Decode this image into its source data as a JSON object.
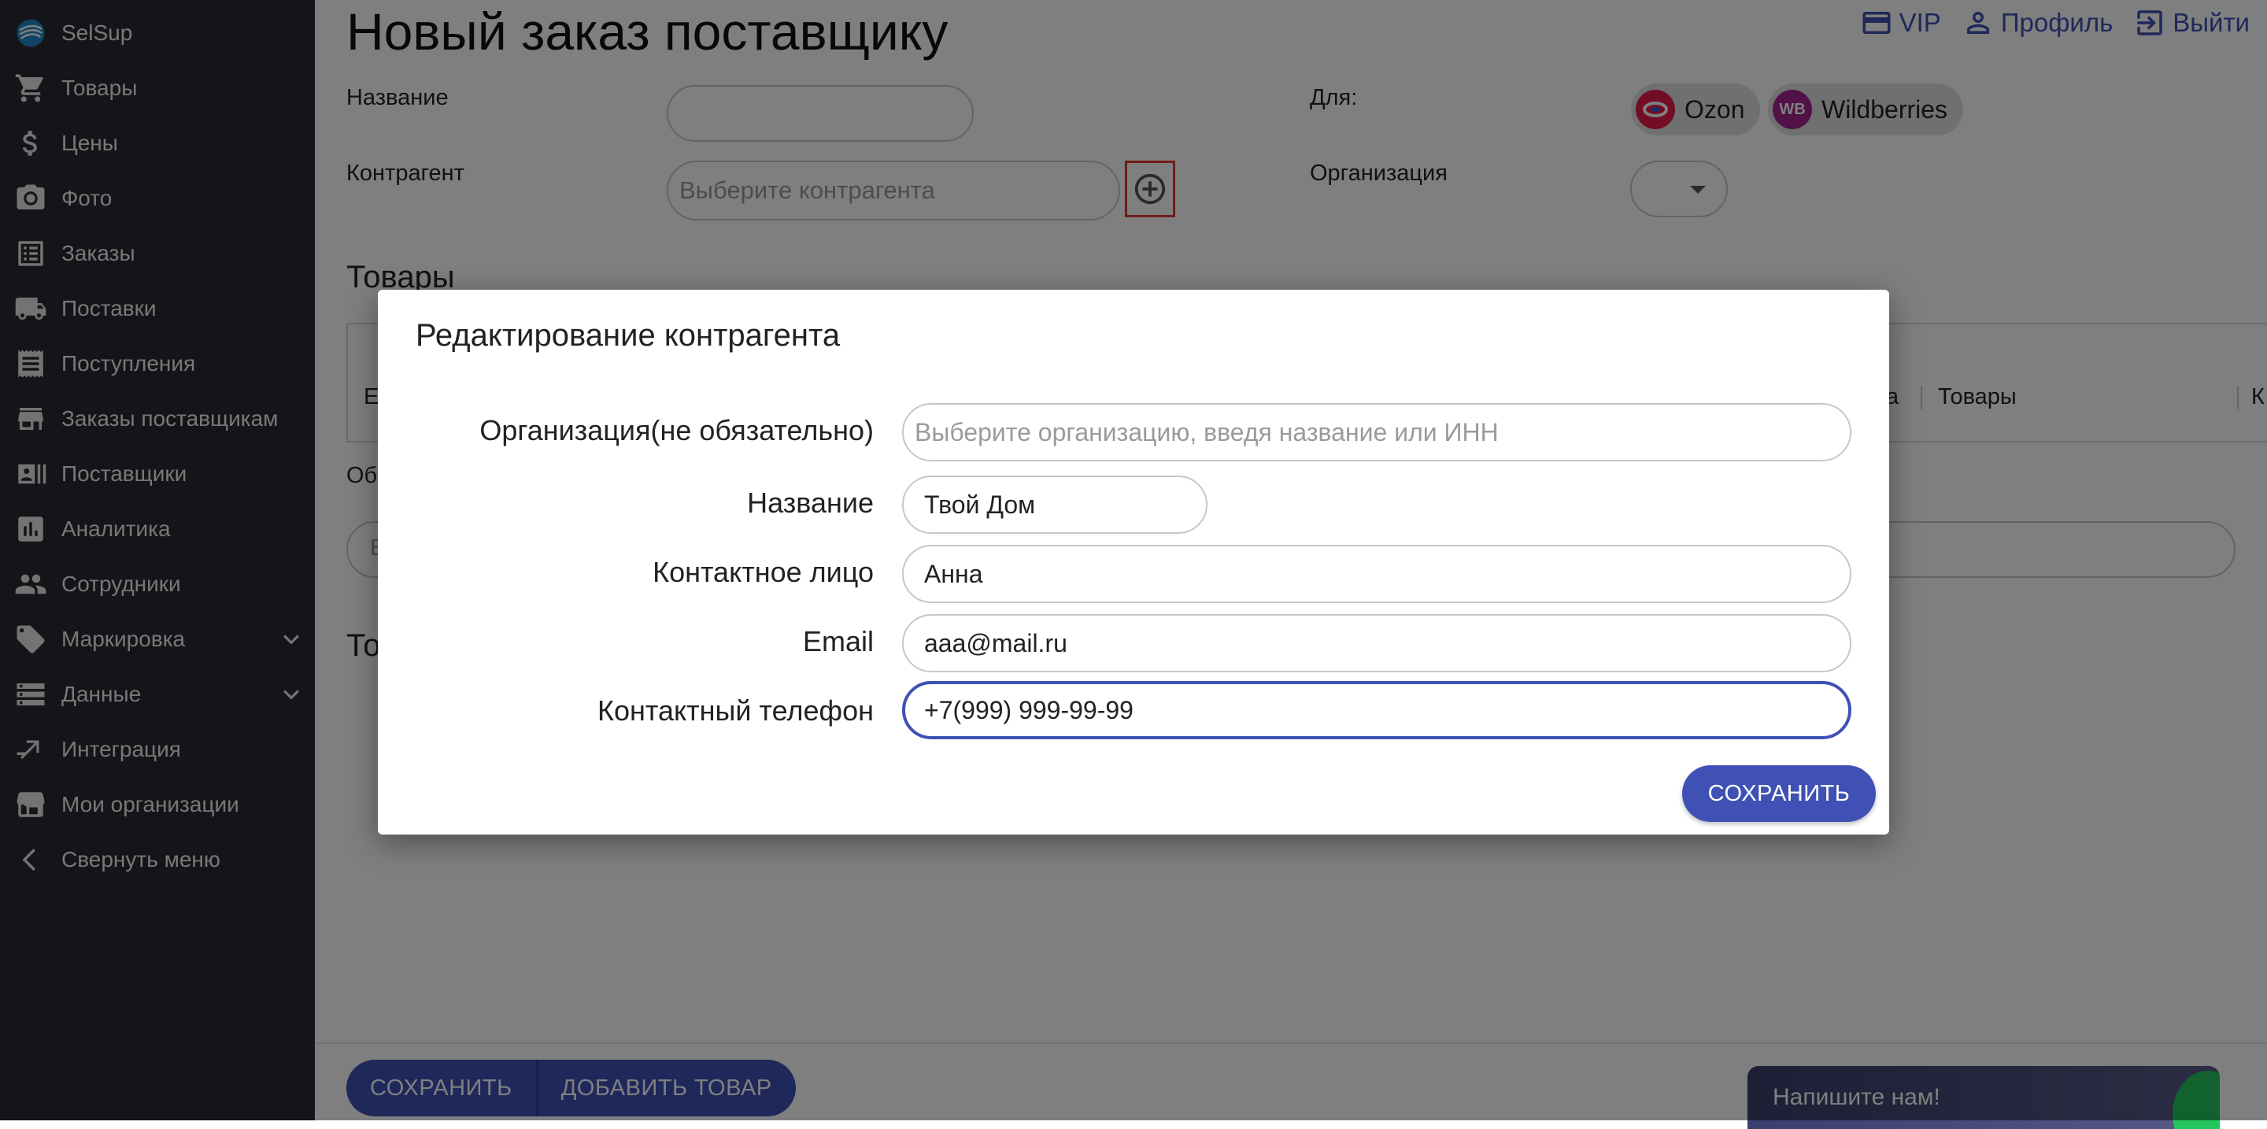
{
  "sidebar": {
    "brand": "SelSup",
    "items": [
      {
        "label": "Товары",
        "icon": "cart-icon"
      },
      {
        "label": "Цены",
        "icon": "dollar-icon"
      },
      {
        "label": "Фото",
        "icon": "camera-icon"
      },
      {
        "label": "Заказы",
        "icon": "list-icon"
      },
      {
        "label": "Поставки",
        "icon": "truck-icon"
      },
      {
        "label": "Поступления",
        "icon": "receipt-icon"
      },
      {
        "label": "Заказы поставщикам",
        "icon": "store-icon"
      },
      {
        "label": "Поставщики",
        "icon": "contacts-icon"
      },
      {
        "label": "Аналитика",
        "icon": "bar-chart-icon"
      },
      {
        "label": "Сотрудники",
        "icon": "people-icon"
      },
      {
        "label": "Маркировка",
        "icon": "tag-icon"
      },
      {
        "label": "Данные",
        "icon": "storage-icon"
      },
      {
        "label": "Интеграция",
        "icon": "swap-icon"
      },
      {
        "label": "Мои организации",
        "icon": "storefront-icon"
      },
      {
        "label": "Свернуть меню",
        "icon": "chevron-left-icon"
      }
    ]
  },
  "header": {
    "title": "Новый заказ поставщику",
    "links": {
      "vip": "VIP",
      "profile": "Профиль",
      "logout": "Выйти"
    }
  },
  "form": {
    "name_label": "Название",
    "name_value": "",
    "counterparty_label": "Контрагент",
    "counterparty_placeholder": "Выберите контрагента",
    "for_label": "Для:",
    "marketplaces": [
      "Ozon",
      "Wildberries"
    ],
    "wb_logo_text": "WB",
    "organization_label": "Организация",
    "organization_value": ""
  },
  "products_section": {
    "title": "Товары",
    "columns_partial": {
      "left": "Е",
      "mid": "на",
      "right": "Товары",
      "far": "К"
    },
    "obs_partial": "Об",
    "input_partial": "В",
    "second_title_partial": "То"
  },
  "bottom_bar": {
    "save_label": "СОХРАНИТЬ",
    "add_product_label": "ДОБАВИТЬ ТОВАР",
    "chat_label": "Напишите нам!"
  },
  "dialog": {
    "title": "Редактирование контрагента",
    "fields": [
      {
        "label": "Организация(не обязательно)",
        "value": "",
        "placeholder": "Выберите организацию, введя название или ИНН"
      },
      {
        "label": "Название",
        "value": "Твой Дом",
        "placeholder": ""
      },
      {
        "label": "Контактное лицо",
        "value": "Анна",
        "placeholder": ""
      },
      {
        "label": "Email",
        "value": "aaa@mail.ru",
        "placeholder": ""
      },
      {
        "label": "Контактный телефон",
        "value": "+7(999) 999-99-99",
        "placeholder": ""
      }
    ],
    "save_label": "СОХРАНИТЬ"
  },
  "colors": {
    "sidebar_bg": "#2b2b33",
    "accent": "#3f51b5",
    "highlight_border": "#e53935",
    "ozon": "#e6194b",
    "wildberries": "#a1258f"
  }
}
